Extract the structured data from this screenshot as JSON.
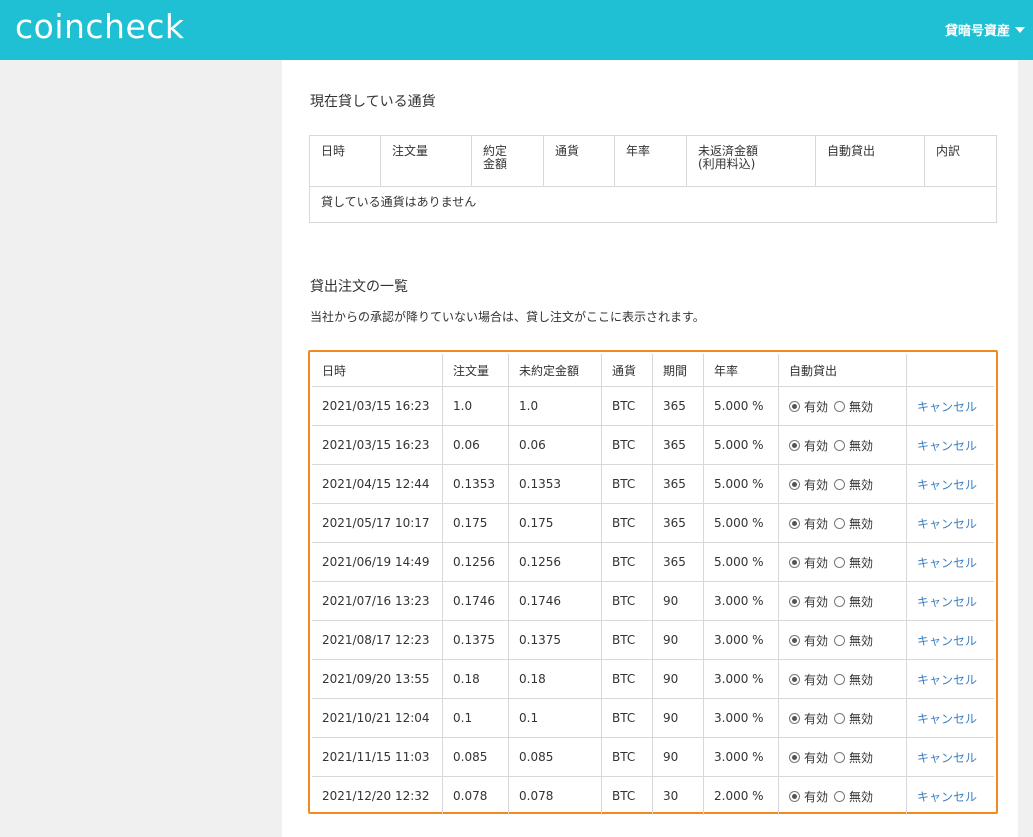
{
  "header": {
    "logo": "coincheck",
    "menu_label": "貸暗号資産"
  },
  "current_section": {
    "title": "現在貸している通貨",
    "columns": [
      "日時",
      "注文量",
      "約定\n金額",
      "通貨",
      "年率",
      "未返済金額\n(利用料込)",
      "自動貸出",
      "内訳"
    ],
    "empty_message": "貸している通貨はありません"
  },
  "orders_section": {
    "title": "貸出注文の一覧",
    "note": "当社からの承認が降りていない場合は、貸し注文がここに表示されます。",
    "columns": [
      "日時",
      "注文量",
      "未約定金額",
      "通貨",
      "期間",
      "年率",
      "自動貸出",
      ""
    ],
    "radio_on_label": "有効",
    "radio_off_label": "無効",
    "cancel_label": "キャンセル",
    "rows": [
      {
        "datetime": "2021/03/15 16:23",
        "amount": "1.0",
        "unfilled": "1.0",
        "currency": "BTC",
        "period": "365",
        "rate": "5.000 %"
      },
      {
        "datetime": "2021/03/15 16:23",
        "amount": "0.06",
        "unfilled": "0.06",
        "currency": "BTC",
        "period": "365",
        "rate": "5.000 %"
      },
      {
        "datetime": "2021/04/15 12:44",
        "amount": "0.1353",
        "unfilled": "0.1353",
        "currency": "BTC",
        "period": "365",
        "rate": "5.000 %"
      },
      {
        "datetime": "2021/05/17 10:17",
        "amount": "0.175",
        "unfilled": "0.175",
        "currency": "BTC",
        "period": "365",
        "rate": "5.000 %"
      },
      {
        "datetime": "2021/06/19 14:49",
        "amount": "0.1256",
        "unfilled": "0.1256",
        "currency": "BTC",
        "period": "365",
        "rate": "5.000 %"
      },
      {
        "datetime": "2021/07/16 13:23",
        "amount": "0.1746",
        "unfilled": "0.1746",
        "currency": "BTC",
        "period": "90",
        "rate": "3.000 %"
      },
      {
        "datetime": "2021/08/17 12:23",
        "amount": "0.1375",
        "unfilled": "0.1375",
        "currency": "BTC",
        "period": "90",
        "rate": "3.000 %"
      },
      {
        "datetime": "2021/09/20 13:55",
        "amount": "0.18",
        "unfilled": "0.18",
        "currency": "BTC",
        "period": "90",
        "rate": "3.000 %"
      },
      {
        "datetime": "2021/10/21 12:04",
        "amount": "0.1",
        "unfilled": "0.1",
        "currency": "BTC",
        "period": "90",
        "rate": "3.000 %"
      },
      {
        "datetime": "2021/11/15 11:03",
        "amount": "0.085",
        "unfilled": "0.085",
        "currency": "BTC",
        "period": "90",
        "rate": "3.000 %"
      },
      {
        "datetime": "2021/12/20 12:32",
        "amount": "0.078",
        "unfilled": "0.078",
        "currency": "BTC",
        "period": "30",
        "rate": "2.000 %"
      }
    ]
  },
  "colors": {
    "header_bg": "#1fc0d4",
    "highlight_border": "#f28a1e",
    "link": "#3d7fc1"
  }
}
